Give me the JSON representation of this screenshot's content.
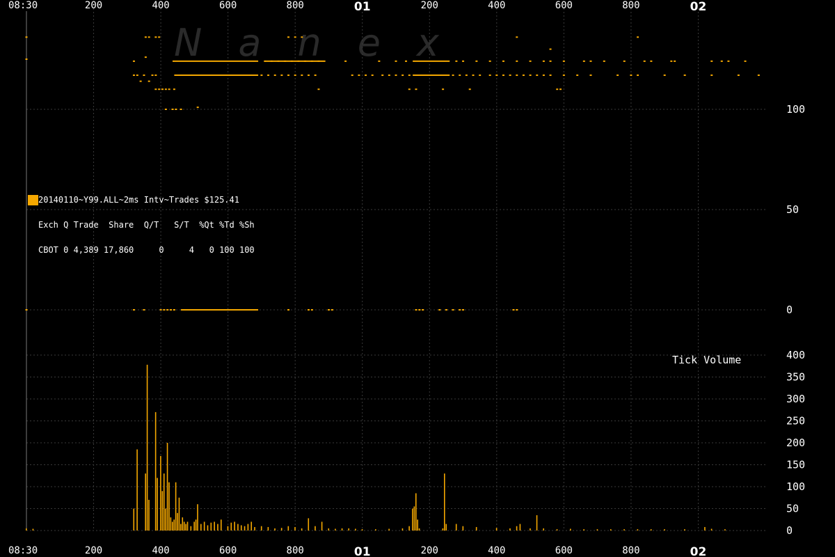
{
  "watermark": "Nanex",
  "info_box": {
    "title": "20140110~Y99.ALL~2ms Intv~Trades $125.41",
    "header": "Exch Q Trade  Share  Q/T   S/T  %Qt %Td %Sh",
    "row": "CBOT 0 4,389 17,860     0     4   0 100 100",
    "swatch_color": "#f5a800"
  },
  "chart_data": [
    {
      "type": "scatter",
      "title": "",
      "x_tick_labels": [
        "08:30",
        "200",
        "400",
        "600",
        "800",
        "01",
        "200",
        "400",
        "600",
        "800",
        "02"
      ],
      "y_tick_labels": [
        "100",
        "50",
        "0"
      ],
      "ylim": [
        0,
        110
      ],
      "grid": true,
      "color": "#f5a800",
      "x_unit": "ms offset within session, 0 = 08:30; 1000 = 01; 2000 = 02",
      "xlim": [
        0,
        2200
      ],
      "series": [
        {
          "name": "",
          "segments": [
            {
              "x0": 435,
              "x1": 690,
              "y": 124
            },
            {
              "x0": 440,
              "x1": 690,
              "y": 117
            },
            {
              "x0": 710,
              "x1": 890,
              "y": 124
            },
            {
              "x0": 1150,
              "x1": 1260,
              "y": 124
            },
            {
              "x0": 1150,
              "x1": 1260,
              "y": 117
            },
            {
              "x0": 460,
              "x1": 690,
              "y": 0
            }
          ]
        },
        {
          "name": "",
          "points": [
            [
              0,
              136
            ],
            [
              0,
              125
            ],
            [
              0,
              0
            ],
            [
              320,
              117
            ],
            [
              320,
              124
            ],
            [
              320,
              0
            ],
            [
              330,
              117
            ],
            [
              340,
              114
            ],
            [
              350,
              117
            ],
            [
              350,
              0
            ],
            [
              355,
              126
            ],
            [
              355,
              136
            ],
            [
              365,
              136
            ],
            [
              365,
              114
            ],
            [
              375,
              117
            ],
            [
              385,
              117
            ],
            [
              385,
              136
            ],
            [
              395,
              136
            ],
            [
              385,
              110
            ],
            [
              395,
              110
            ],
            [
              405,
              110
            ],
            [
              415,
              110
            ],
            [
              425,
              110
            ],
            [
              440,
              110
            ],
            [
              415,
              100
            ],
            [
              435,
              100
            ],
            [
              445,
              100
            ],
            [
              460,
              100
            ],
            [
              510,
              101
            ],
            [
              400,
              0
            ],
            [
              410,
              0
            ],
            [
              420,
              0
            ],
            [
              430,
              0
            ],
            [
              440,
              0
            ],
            [
              700,
              117
            ],
            [
              720,
              117
            ],
            [
              740,
              117
            ],
            [
              760,
              117
            ],
            [
              780,
              117
            ],
            [
              800,
              117
            ],
            [
              820,
              117
            ],
            [
              840,
              117
            ],
            [
              860,
              117
            ],
            [
              710,
              124
            ],
            [
              730,
              124
            ],
            [
              750,
              124
            ],
            [
              770,
              124
            ],
            [
              790,
              124
            ],
            [
              810,
              124
            ],
            [
              830,
              124
            ],
            [
              850,
              124
            ],
            [
              870,
              124
            ],
            [
              780,
              136
            ],
            [
              800,
              136
            ],
            [
              820,
              136
            ],
            [
              870,
              110
            ],
            [
              950,
              124
            ],
            [
              970,
              117
            ],
            [
              990,
              117
            ],
            [
              1010,
              117
            ],
            [
              1030,
              117
            ],
            [
              1060,
              117
            ],
            [
              1080,
              117
            ],
            [
              1100,
              117
            ],
            [
              1120,
              117
            ],
            [
              1140,
              117
            ],
            [
              1050,
              124
            ],
            [
              1100,
              124
            ],
            [
              1130,
              124
            ],
            [
              1140,
              110
            ],
            [
              1160,
              110
            ],
            [
              1240,
              110
            ],
            [
              1320,
              110
            ],
            [
              1270,
              117
            ],
            [
              1290,
              117
            ],
            [
              1310,
              117
            ],
            [
              1330,
              117
            ],
            [
              1350,
              117
            ],
            [
              1380,
              117
            ],
            [
              1400,
              117
            ],
            [
              1420,
              117
            ],
            [
              1440,
              117
            ],
            [
              1460,
              117
            ],
            [
              1480,
              117
            ],
            [
              1500,
              117
            ],
            [
              1520,
              117
            ],
            [
              1540,
              117
            ],
            [
              1560,
              117
            ],
            [
              1280,
              124
            ],
            [
              1300,
              124
            ],
            [
              1340,
              124
            ],
            [
              1380,
              124
            ],
            [
              1420,
              124
            ],
            [
              1460,
              124
            ],
            [
              1500,
              124
            ],
            [
              1540,
              124
            ],
            [
              1560,
              124
            ],
            [
              1600,
              124
            ],
            [
              1660,
              124
            ],
            [
              1680,
              124
            ],
            [
              1720,
              124
            ],
            [
              1780,
              124
            ],
            [
              1460,
              136
            ],
            [
              1560,
              130
            ],
            [
              1600,
              117
            ],
            [
              1640,
              117
            ],
            [
              1680,
              117
            ],
            [
              1760,
              117
            ],
            [
              1800,
              117
            ],
            [
              1820,
              117
            ],
            [
              1580,
              110
            ],
            [
              1590,
              110
            ],
            [
              1820,
              136
            ],
            [
              1840,
              124
            ],
            [
              1860,
              124
            ],
            [
              1920,
              124
            ],
            [
              1930,
              124
            ],
            [
              2040,
              124
            ],
            [
              2070,
              124
            ],
            [
              2090,
              124
            ],
            [
              2140,
              124
            ],
            [
              1900,
              117
            ],
            [
              1960,
              117
            ],
            [
              2040,
              117
            ],
            [
              2120,
              117
            ],
            [
              2180,
              117
            ],
            [
              780,
              0
            ],
            [
              840,
              0
            ],
            [
              850,
              0
            ],
            [
              900,
              0
            ],
            [
              910,
              0
            ],
            [
              1160,
              0
            ],
            [
              1170,
              0
            ],
            [
              1180,
              0
            ],
            [
              1230,
              0
            ],
            [
              1250,
              0
            ],
            [
              1270,
              0
            ],
            [
              1290,
              0
            ],
            [
              1300,
              0
            ],
            [
              1450,
              0
            ],
            [
              1460,
              0
            ]
          ]
        }
      ]
    },
    {
      "type": "bar",
      "title": "Tick Volume",
      "x_tick_labels": [
        "08:30",
        "200",
        "400",
        "600",
        "800",
        "01",
        "200",
        "400",
        "600",
        "800",
        "02"
      ],
      "y_tick_labels": [
        "400",
        "350",
        "300",
        "250",
        "200",
        "150",
        "100",
        "50",
        "0"
      ],
      "ylim": [
        0,
        400
      ],
      "grid": true,
      "color": "#f5a800",
      "xlim": [
        0,
        2200
      ],
      "x": [
        0,
        20,
        320,
        330,
        355,
        360,
        365,
        385,
        390,
        400,
        405,
        410,
        415,
        420,
        425,
        430,
        435,
        440,
        445,
        450,
        455,
        460,
        465,
        470,
        475,
        480,
        490,
        500,
        505,
        510,
        520,
        530,
        540,
        550,
        560,
        570,
        580,
        600,
        610,
        620,
        630,
        640,
        650,
        660,
        670,
        680,
        700,
        720,
        740,
        760,
        780,
        800,
        820,
        840,
        860,
        880,
        900,
        920,
        940,
        960,
        980,
        1000,
        1040,
        1080,
        1120,
        1140,
        1150,
        1155,
        1160,
        1165,
        1170,
        1240,
        1245,
        1250,
        1280,
        1300,
        1340,
        1400,
        1440,
        1460,
        1470,
        1500,
        1520,
        1540,
        1580,
        1620,
        1660,
        1700,
        1740,
        1780,
        1820,
        1860,
        1900,
        1960,
        2020,
        2040,
        2080
      ],
      "values": [
        5,
        4,
        50,
        185,
        130,
        378,
        70,
        270,
        120,
        170,
        90,
        130,
        50,
        200,
        110,
        30,
        20,
        25,
        110,
        40,
        75,
        15,
        30,
        20,
        15,
        20,
        10,
        20,
        25,
        60,
        15,
        20,
        12,
        18,
        20,
        15,
        25,
        10,
        18,
        20,
        15,
        12,
        10,
        15,
        20,
        8,
        10,
        8,
        5,
        6,
        10,
        8,
        5,
        28,
        10,
        20,
        5,
        4,
        5,
        5,
        4,
        3,
        3,
        4,
        5,
        10,
        50,
        55,
        85,
        25,
        5,
        5,
        130,
        15,
        15,
        10,
        8,
        6,
        5,
        10,
        15,
        5,
        35,
        5,
        3,
        4,
        3,
        3,
        3,
        3,
        3,
        3,
        3,
        3,
        8,
        4,
        3
      ]
    }
  ]
}
